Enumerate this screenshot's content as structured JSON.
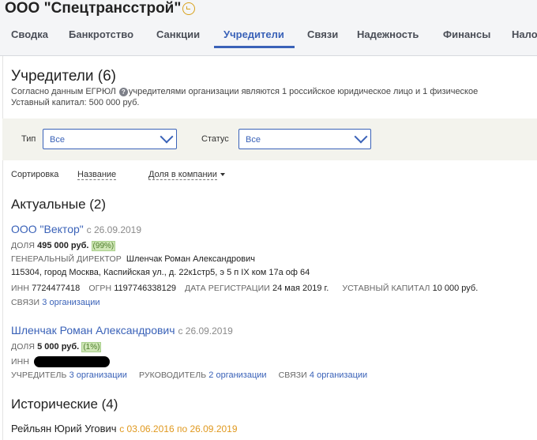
{
  "header": {
    "company_name": "ООО \"Спецтрансстрой\"",
    "tabs": [
      {
        "label": "Сводка",
        "active": false
      },
      {
        "label": "Банкротство",
        "active": false
      },
      {
        "label": "Санкции",
        "active": false
      },
      {
        "label": "Учредители",
        "active": true
      },
      {
        "label": "Связи",
        "active": false
      },
      {
        "label": "Надежность",
        "active": false
      },
      {
        "label": "Финансы",
        "active": false
      },
      {
        "label": "Нало",
        "active": false
      }
    ]
  },
  "founders": {
    "title": "Учредители (6)",
    "info_prefix": "Согласно данным ЕГРЮЛ",
    "info_text": "учредителями организации являются 1 российское юридическое лицо и 1 физическое",
    "capital": "Уставный капитал: 500 000 руб."
  },
  "filters": {
    "type_label": "Тип",
    "type_value": "Все",
    "status_label": "Статус",
    "status_value": "Все"
  },
  "sort": {
    "label": "Сортировка",
    "by_name": "Название",
    "by_share": "Доля в компании"
  },
  "current": {
    "title": "Актуальные (2)",
    "items": [
      {
        "name": "ООО \"Вектор\"",
        "since": "с 26.09.2019",
        "share_label": "ДОЛЯ",
        "share_value": "495 000 руб.",
        "share_pct": "(99%)",
        "director_label": "ГЕНЕРАЛЬНЫЙ ДИРЕКТОР",
        "director_name": "Шленчак Роман Александрович",
        "address": "115304, город Москва, Каспийская ул., д. 22к1стр5, э 5 п IX ком 17а оф 64",
        "inn_label": "ИНН",
        "inn_value": "7724477418",
        "ogrn_label": "ОГРН",
        "ogrn_value": "1197746338129",
        "reg_label": "ДАТА РЕГИСТРАЦИИ",
        "reg_value": "24 мая 2019 г.",
        "capital_label": "УСТАВНЫЙ КАПИТАЛ",
        "capital_value": "10 000 руб.",
        "links_label": "СВЯЗИ",
        "links_value": "3 организации"
      },
      {
        "name": "Шленчак Роман Александрович",
        "since": "с 26.09.2019",
        "share_label": "ДОЛЯ",
        "share_value": "5 000 руб.",
        "share_pct": "(1%)",
        "inn_label": "ИНН",
        "founder_label": "УЧРЕДИТЕЛЬ",
        "founder_value": "3 организации",
        "head_label": "РУКОВОДИТЕЛЬ",
        "head_value": "2 организации",
        "links_label": "СВЯЗИ",
        "links_value": "4 организации"
      }
    ]
  },
  "historical": {
    "title": "Исторические (4)",
    "items": [
      {
        "name": "Рейльян Юрий Угович",
        "period": "с 03.06.2016 по 26.09.2019"
      }
    ]
  },
  "colors": {
    "accent": "#3a62b8",
    "historical_date": "#e0991f",
    "share_badge_bg": "#cfe6b6"
  },
  "icons": [
    "status-icon",
    "info-icon",
    "chevron-down-icon",
    "sort-caret-icon"
  ]
}
